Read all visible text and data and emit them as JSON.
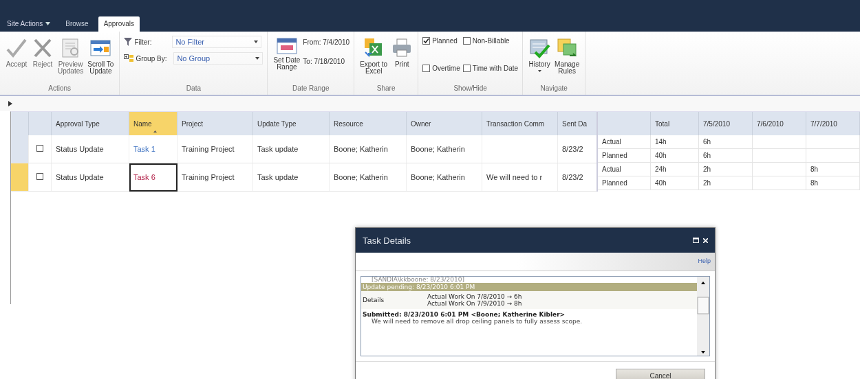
{
  "top_bar": {
    "site_actions": "Site Actions"
  },
  "tabs": [
    {
      "label": "Browse",
      "selected": false
    },
    {
      "label": "Approvals",
      "selected": true
    }
  ],
  "ribbon": {
    "actions": {
      "title": "Actions",
      "buttons": [
        {
          "label": "Accept",
          "disabled": true
        },
        {
          "label": "Reject",
          "disabled": true
        },
        {
          "label": "Preview\nUpdates",
          "disabled": true
        },
        {
          "label": "Scroll To\nUpdate",
          "disabled": false
        }
      ]
    },
    "data": {
      "title": "Data",
      "filter_label": "Filter:",
      "filter_value": "No Filter",
      "group_label": "Group By:",
      "group_value": "No Group"
    },
    "date_range": {
      "title": "Date Range",
      "button": "Set Date\nRange",
      "from": "From: 7/4/2010",
      "to": "To: 7/18/2010"
    },
    "share": {
      "title": "Share",
      "buttons": [
        "Export to\nExcel",
        "Print"
      ]
    },
    "show_hide": {
      "title": "Show/Hide",
      "options": [
        {
          "label": "Planned",
          "checked": true
        },
        {
          "label": "Non-Billable",
          "checked": false
        },
        {
          "label": "Overtime",
          "checked": false
        },
        {
          "label": "Time with Date",
          "checked": false
        }
      ]
    },
    "navigate": {
      "title": "Navigate",
      "buttons": [
        "History",
        "Manage\nRules"
      ]
    }
  },
  "grid": {
    "columns": [
      {
        "label": "Approval Type",
        "sorted": false
      },
      {
        "label": "Name",
        "sorted": true
      },
      {
        "label": "Project",
        "sorted": false
      },
      {
        "label": "Update Type",
        "sorted": false
      },
      {
        "label": "Resource",
        "sorted": false
      },
      {
        "label": "Owner",
        "sorted": false
      },
      {
        "label": "Transaction Comm",
        "sorted": false
      },
      {
        "label": "Sent Da",
        "sorted": false
      }
    ],
    "rows": [
      {
        "selected": false,
        "checked": false,
        "approval_type": "Status Update",
        "name": "Task 1",
        "project": "Training Project",
        "update_type": "Task update",
        "resource": "Boone; Katherin",
        "owner": "Boone; Katherin",
        "sent_date": "8/23/2"
      },
      {
        "selected": true,
        "checked": false,
        "approval_type": "Status Update",
        "name": "Task 6",
        "project": "Training Project",
        "update_type": "Task update",
        "resource": "Boone; Katherin",
        "owner": "Boone; Katherin",
        "transaction_comment": "We will need to r",
        "sent_date": "8/23/2"
      }
    ]
  },
  "timesheet": {
    "columns": [
      "Total",
      "7/5/2010",
      "7/6/2010",
      "7/7/2010"
    ],
    "rows": [
      {
        "label": "Actual",
        "total": "14h",
        "day_1": "6h"
      },
      {
        "label": "Planned",
        "total": "40h",
        "day_1": "6h"
      },
      {
        "label": "Actual",
        "total": "24h",
        "day_1": "2h",
        "day_3": "8h"
      },
      {
        "label": "Planned",
        "total": "40h",
        "day_1": "2h",
        "day_3": "8h"
      }
    ]
  },
  "dialog": {
    "title": "Task Details",
    "help": "Help",
    "cut_line": "[SANDIA\\kkboone: 8/23/2010]",
    "pending": "Update pending: 8/23/2010 6:01 PM",
    "details_label": "Details",
    "details": [
      "Actual Work On 7/8/2010 → 6h",
      "Actual Work On 7/9/2010 → 8h"
    ],
    "submitted": "Submitted: 8/23/2010 6:01 PM <Boone; Katherine Kibler>",
    "comment": "We will need to remove all drop ceiling panels to fully assess scope.",
    "cancel": "Cancel"
  }
}
